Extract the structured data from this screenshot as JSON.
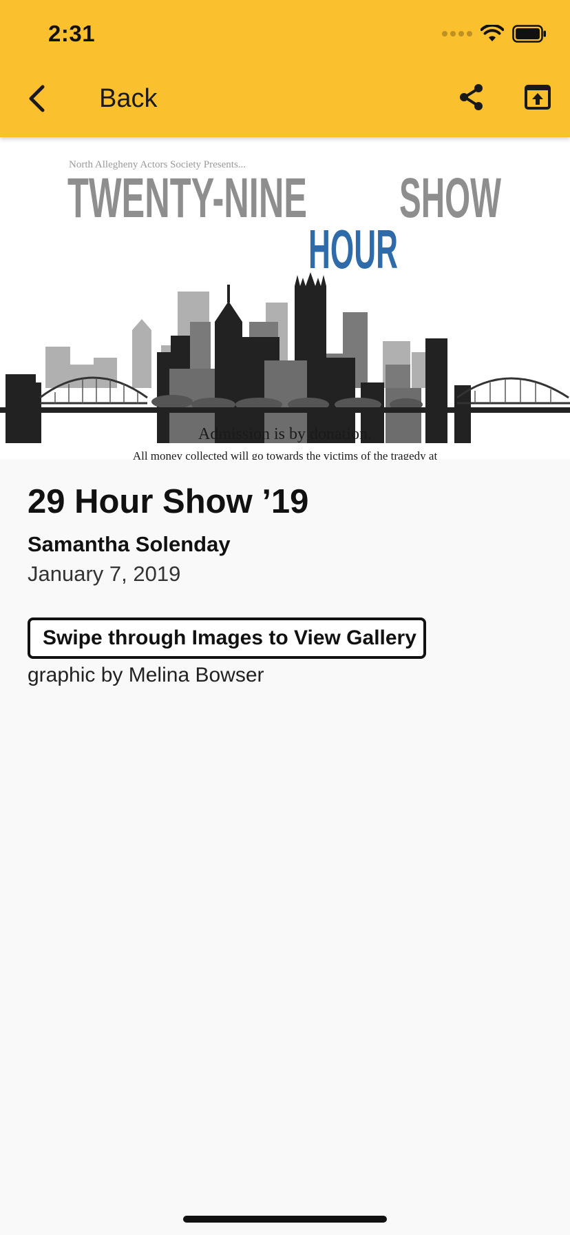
{
  "status_bar": {
    "time": "2:31"
  },
  "nav": {
    "back_label": "Back"
  },
  "hero": {
    "presenter_line": "North Allegheny Actors Society Presents...",
    "word_left": "TWENTY-NINE",
    "word_center": "HOUR",
    "word_right": "SHOW",
    "admission_text": "Admission is by donation.",
    "money_text": "All money collected will go towards the victims of the tragedy at",
    "colors": {
      "gray_title": "#8e8e8e",
      "blue_title": "#2f6aa9",
      "skyline": "#222222"
    }
  },
  "article": {
    "title": "29 Hour Show ’19",
    "author": "Samantha Solenday",
    "date": "January 7, 2019",
    "gallery_button": "Swipe through Images to View Gallery",
    "credit": "graphic by Melina Bowser"
  },
  "colors": {
    "accent": "#fbc02d",
    "background": "#f9f9f9",
    "text": "#111111"
  }
}
